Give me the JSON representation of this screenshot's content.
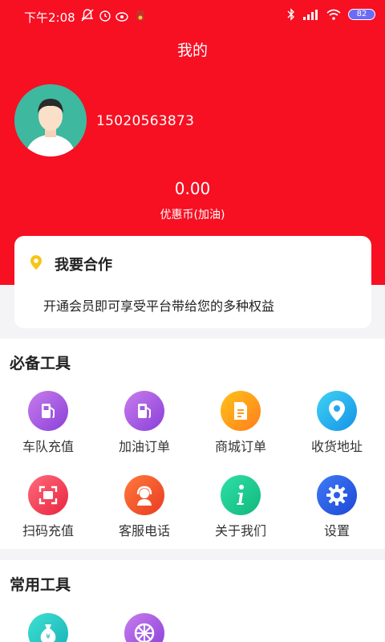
{
  "status_bar": {
    "time": "下午2:08",
    "battery": "82"
  },
  "page_title": "我的",
  "profile": {
    "phone": "15020563873"
  },
  "coupon": {
    "value": "0.00",
    "label": "优惠币(加油)"
  },
  "cooperation": {
    "title": "我要合作",
    "description": "开通会员即可享受平台带给您的多种权益"
  },
  "essential_tools": {
    "title": "必备工具",
    "items": [
      {
        "label": "车队充值",
        "icon": "fuel-pump-icon"
      },
      {
        "label": "加油订单",
        "icon": "fuel-pump-icon"
      },
      {
        "label": "商城订单",
        "icon": "document-icon"
      },
      {
        "label": "收货地址",
        "icon": "location-pin-icon"
      },
      {
        "label": "扫码充值",
        "icon": "scan-icon"
      },
      {
        "label": "客服电话",
        "icon": "headset-icon"
      },
      {
        "label": "关于我们",
        "icon": "info-icon"
      },
      {
        "label": "设置",
        "icon": "gear-icon"
      }
    ]
  },
  "common_tools": {
    "title": "常用工具",
    "items": [
      {
        "icon": "money-bag-icon"
      },
      {
        "icon": "wheel-icon"
      }
    ]
  }
}
